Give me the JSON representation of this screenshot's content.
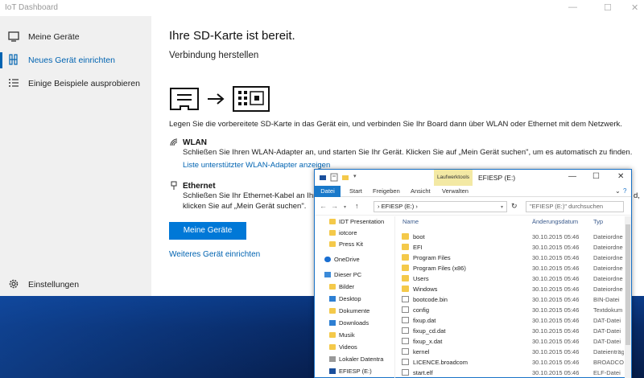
{
  "iot": {
    "window_title": "IoT Dashboard",
    "nav": [
      {
        "label": "Meine Geräte",
        "icon": "device-icon"
      },
      {
        "label": "Neues Gerät einrichten",
        "icon": "setup-icon"
      },
      {
        "label": "Einige Beispiele ausprobieren",
        "icon": "list-icon"
      }
    ],
    "settings_label": "Einstellungen",
    "heading": "Ihre SD-Karte ist bereit.",
    "subheading": "Verbindung herstellen",
    "description": "Legen Sie die vorbereitete SD-Karte in das Gerät ein, und verbinden Sie Ihr Board dann über WLAN oder Ethernet mit dem Netzwerk.",
    "wlan": {
      "title": "WLAN",
      "text": "Schließen Sie Ihren WLAN-Adapter an, und starten Sie Ihr Gerät. Klicken Sie auf „Mein Gerät suchen\", um es automatisch zu finden.",
      "link": "Liste unterstützter WLAN-Adapter anzeigen"
    },
    "ethernet": {
      "title": "Ethernet",
      "text_line1": "Schließen Sie Ihr Ethernet-Kabel an Ihr B",
      "text_line1_tail": "d,",
      "text_line2": "klicken Sie auf „Mein Gerät suchen\"."
    },
    "primary_button": "Meine Geräte",
    "secondary_link": "Weiteres Gerät einrichten",
    "accent": "#0078d7"
  },
  "explorer": {
    "title": "EFIESP (E:)",
    "context_tab": "Laufwerktools",
    "ribbon_tabs": [
      "Datei",
      "Start",
      "Freigeben",
      "Ansicht",
      "Verwalten"
    ],
    "address": "EFIESP (E:)",
    "search_placeholder": "\"EFIESP (E:)\" durchsuchen",
    "tree": [
      {
        "label": "IDT Presentation",
        "type": "folder"
      },
      {
        "label": "iotcore",
        "type": "folder"
      },
      {
        "label": "Press Kit",
        "type": "folder"
      },
      {
        "label": "OneDrive",
        "type": "cloud"
      },
      {
        "label": "Dieser PC",
        "type": "pc"
      },
      {
        "label": "Bilder",
        "type": "folder"
      },
      {
        "label": "Desktop",
        "type": "folder"
      },
      {
        "label": "Dokumente",
        "type": "folder"
      },
      {
        "label": "Downloads",
        "type": "folder"
      },
      {
        "label": "Musik",
        "type": "folder"
      },
      {
        "label": "Videos",
        "type": "folder"
      },
      {
        "label": "Lokaler Datentra",
        "type": "drive"
      },
      {
        "label": "EFIESP (E:)",
        "type": "drive"
      }
    ],
    "columns": [
      "Name",
      "Änderungsdatum",
      "Typ"
    ],
    "files": [
      {
        "name": "boot",
        "date": "30.10.2015 05:46",
        "type": "Dateiordne",
        "kind": "folder"
      },
      {
        "name": "EFI",
        "date": "30.10.2015 05:46",
        "type": "Dateiordne",
        "kind": "folder"
      },
      {
        "name": "Program Files",
        "date": "30.10.2015 05:46",
        "type": "Dateiordne",
        "kind": "folder"
      },
      {
        "name": "Program Files (x86)",
        "date": "30.10.2015 05:46",
        "type": "Dateiordne",
        "kind": "folder"
      },
      {
        "name": "Users",
        "date": "30.10.2015 05:46",
        "type": "Dateiordne",
        "kind": "folder"
      },
      {
        "name": "Windows",
        "date": "30.10.2015 05:46",
        "type": "Dateiordne",
        "kind": "folder"
      },
      {
        "name": "bootcode.bin",
        "date": "30.10.2015 05:46",
        "type": "BIN-Datei",
        "kind": "doc"
      },
      {
        "name": "config",
        "date": "30.10.2015 05:46",
        "type": "Textdokum",
        "kind": "doc"
      },
      {
        "name": "fixup.dat",
        "date": "30.10.2015 05:46",
        "type": "DAT-Datei",
        "kind": "doc"
      },
      {
        "name": "fixup_cd.dat",
        "date": "30.10.2015 05:46",
        "type": "DAT-Datei",
        "kind": "doc"
      },
      {
        "name": "fixup_x.dat",
        "date": "30.10.2015 05:46",
        "type": "DAT-Datei",
        "kind": "doc"
      },
      {
        "name": "kernel",
        "date": "30.10.2015 05:46",
        "type": "Dateienträge",
        "kind": "doc"
      },
      {
        "name": "LICENCE.broadcom",
        "date": "30.10.2015 05:46",
        "type": "BROADCOM",
        "kind": "doc"
      },
      {
        "name": "start.elf",
        "date": "30.10.2015 05:46",
        "type": "ELF-Datei",
        "kind": "doc"
      }
    ]
  }
}
